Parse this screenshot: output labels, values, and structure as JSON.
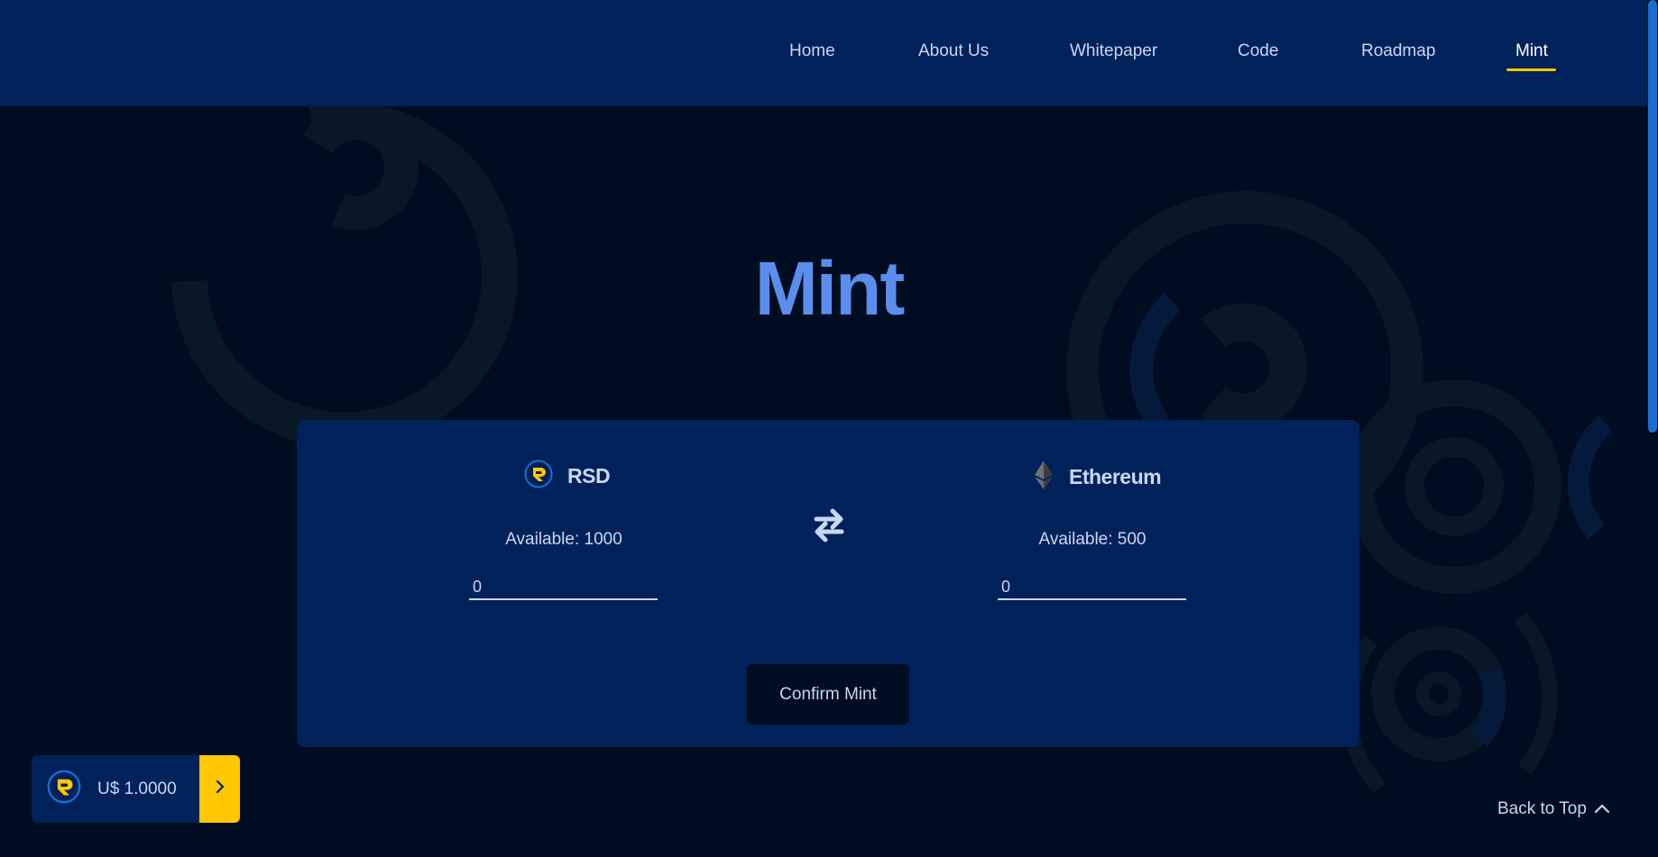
{
  "nav": {
    "items": [
      {
        "label": "Home"
      },
      {
        "label": "About Us"
      },
      {
        "label": "Whitepaper"
      },
      {
        "label": "Code"
      },
      {
        "label": "Roadmap"
      },
      {
        "label": "Mint",
        "active": true
      }
    ]
  },
  "page": {
    "title": "Mint"
  },
  "mint": {
    "from": {
      "name": "RSD",
      "icon": "rsd-coin-icon",
      "available": "Available: 1000",
      "amount": "0"
    },
    "to": {
      "name": "Ethereum",
      "icon": "ethereum-icon",
      "available": "Available: 500",
      "amount": "0"
    },
    "swap_icon": "swap-arrows-icon",
    "confirm_label": "Confirm Mint"
  },
  "price_widget": {
    "value": "U$ 1.0000",
    "icon": "rsd-coin-icon",
    "arrow_icon": "chevron-right-icon"
  },
  "back_to_top": {
    "label": "Back to Top",
    "icon": "chevron-up-icon"
  },
  "colors": {
    "background": "#000c1f",
    "navbar": "#01215a",
    "card": "#01215a",
    "accent": "#ffc800",
    "title": "#5b8def",
    "text": "#c9d7f2",
    "scrollbar": "#1c6dd0"
  }
}
